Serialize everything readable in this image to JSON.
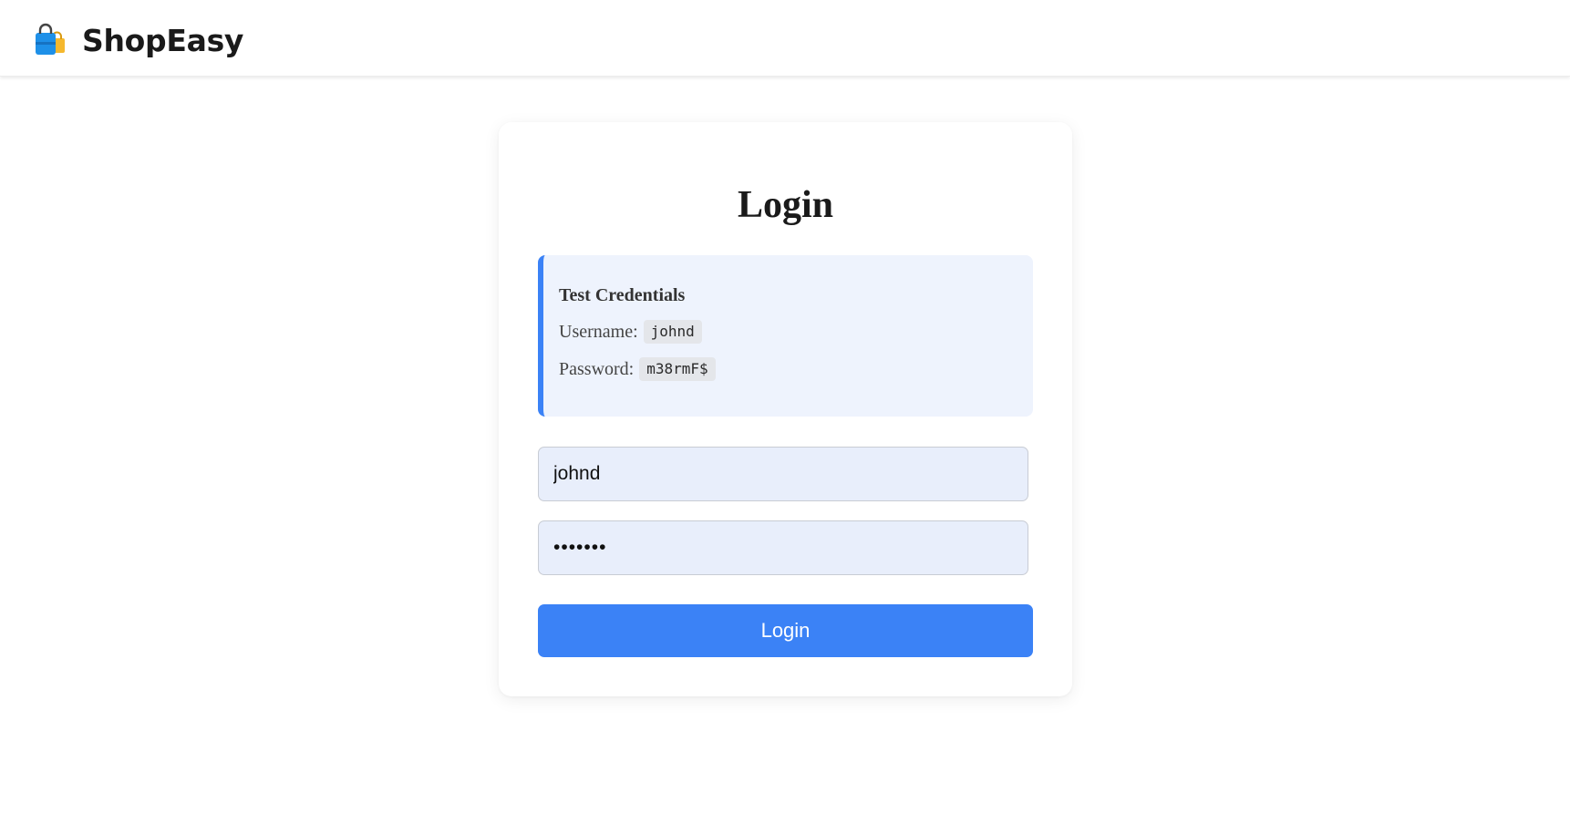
{
  "header": {
    "brand_name": "ShopEasy",
    "brand_icon": "shopping-bags-icon"
  },
  "login": {
    "title": "Login",
    "credentials": {
      "heading": "Test Credentials",
      "username_label": "Username:",
      "username_value": "johnd",
      "password_label": "Password:",
      "password_value": "m38rmF$"
    },
    "username_field": {
      "value": "johnd"
    },
    "password_field": {
      "value": "m38rmF$",
      "type": "password"
    },
    "submit_label": "Login"
  },
  "colors": {
    "accent": "#3b82f6",
    "credentials_bg": "#eef3fd",
    "field_bg": "#e8eefb"
  }
}
